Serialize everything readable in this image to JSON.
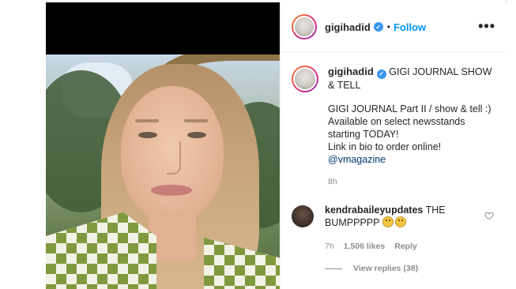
{
  "post": {
    "author": "gigihadid",
    "follow_label": "Follow",
    "dot": "•",
    "more_label": "•••",
    "caption": {
      "title": "GIGI JOURNAL SHOW & TELL",
      "body": "GIGI JOURNAL Part II / show & tell :)\nAvailable on select newsstands starting TODAY!\nLink in bio to order online!",
      "mention": "@vmagazine",
      "time": "8h"
    },
    "comment": {
      "user": "kendrabaileyupdates",
      "text": "THE BUMPPPPP",
      "time": "7h",
      "likes": "1,506 likes",
      "reply_label": "Reply",
      "view_replies": "View replies (38)"
    }
  },
  "colors": {
    "accent": "#0095f6",
    "verified": "#3897f0",
    "muted": "#8e8e8e",
    "mention": "#00376b"
  },
  "icons": {
    "verified": "verified-badge-icon",
    "more": "more-options-icon",
    "heart": "heart-outline-icon",
    "emoji": "grimacing-face-emoji-icon"
  }
}
